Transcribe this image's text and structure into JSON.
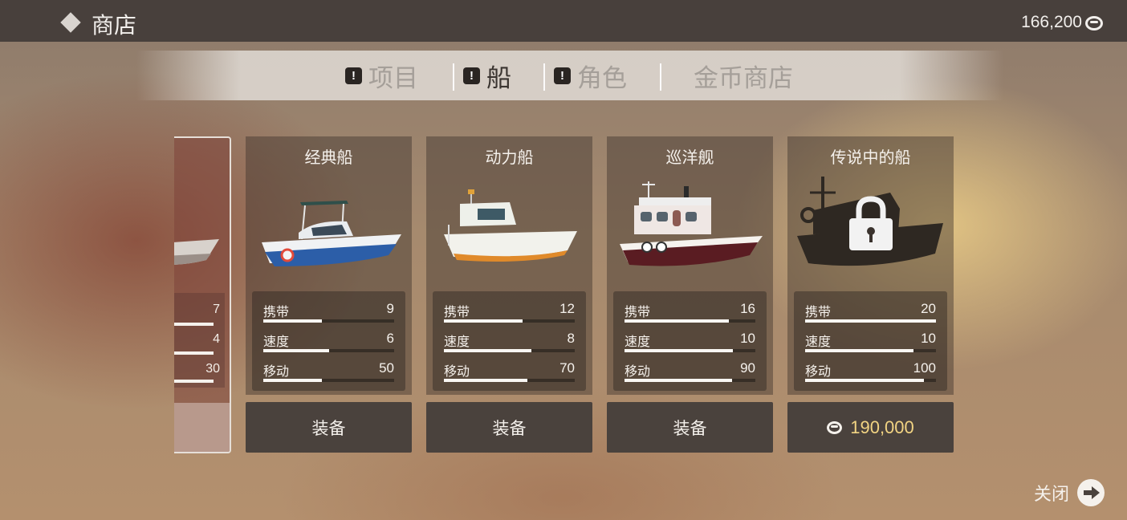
{
  "header": {
    "title": "商店",
    "balance": "166,200",
    "coin_icon": "coin-icon"
  },
  "tabs": [
    {
      "label": "项目",
      "alert": "!",
      "active": false
    },
    {
      "label": "船",
      "alert": "!",
      "active": true
    },
    {
      "label": "角色",
      "alert": "!",
      "active": false
    },
    {
      "label": "金币商店",
      "active": false
    }
  ],
  "stat_labels": {
    "carry": "携带",
    "speed": "速度",
    "move": "移动"
  },
  "partial_card": {
    "values": [
      "7",
      "4",
      "30"
    ]
  },
  "boats": [
    {
      "name": "经典船",
      "stats": {
        "carry": "9",
        "speed": "6",
        "move": "50"
      },
      "levels": {
        "carry": 0.45,
        "speed": 0.5,
        "move": 0.45
      },
      "action": "装备",
      "locked": false
    },
    {
      "name": "动力船",
      "stats": {
        "carry": "12",
        "speed": "8",
        "move": "70"
      },
      "levels": {
        "carry": 0.6,
        "speed": 0.67,
        "move": 0.64
      },
      "action": "装备",
      "locked": false
    },
    {
      "name": "巡洋舰",
      "stats": {
        "carry": "16",
        "speed": "10",
        "move": "90"
      },
      "levels": {
        "carry": 0.8,
        "speed": 0.83,
        "move": 0.82
      },
      "action": "装备",
      "locked": false
    },
    {
      "name": "传说中的船",
      "stats": {
        "carry": "20",
        "speed": "10",
        "move": "100"
      },
      "levels": {
        "carry": 1.0,
        "speed": 0.83,
        "move": 0.91
      },
      "price": "190,000",
      "locked": true
    }
  ],
  "close": {
    "label": "关闭",
    "icon": "arrow-right-icon"
  }
}
